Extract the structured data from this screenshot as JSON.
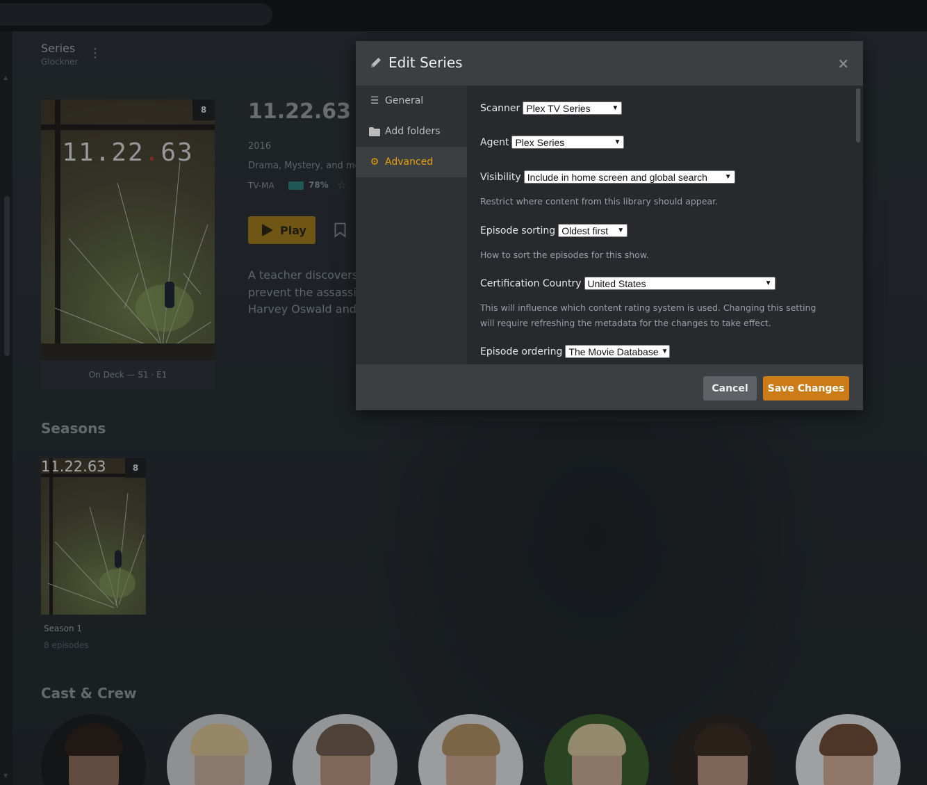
{
  "breadcrumb": {
    "title": "Series",
    "subtitle": "Glockner"
  },
  "show": {
    "poster_title_a": "11.22",
    "poster_title_dot": ".",
    "poster_title_b": "63",
    "poster_badge": "8",
    "on_deck": "On Deck — S1 · E1",
    "title": "11.22.63",
    "year": "2016",
    "genres": "Drama, Mystery, and mo",
    "content_rating": "TV-MA",
    "critic_score": "78%",
    "play_label": "Play",
    "summary_lines": [
      "A teacher discovers a",
      "prevent the assassina",
      "Harvey Oswald and th"
    ]
  },
  "seasons": {
    "heading": "Seasons",
    "items": [
      {
        "label": "Season 1",
        "count": "8 episodes",
        "badge": "8"
      }
    ]
  },
  "cast": {
    "heading": "Cast & Crew"
  },
  "modal": {
    "title": "Edit Series",
    "close": "×",
    "nav": [
      {
        "label": "General",
        "icon": "list-icon"
      },
      {
        "label": "Add folders",
        "icon": "folder-icon"
      },
      {
        "label": "Advanced",
        "icon": "gear-icon",
        "active": true
      }
    ],
    "fields": {
      "scanner": {
        "label": "Scanner",
        "value": "Plex TV Series"
      },
      "agent": {
        "label": "Agent",
        "value": "Plex Series"
      },
      "visibility": {
        "label": "Visibility",
        "value": "Include in home screen and global search",
        "help": "Restrict where content from this library should appear."
      },
      "episode_sorting": {
        "label": "Episode sorting",
        "value": "Oldest first",
        "help": "How to sort the episodes for this show."
      },
      "certification_country": {
        "label": "Certification Country",
        "value": "United States",
        "help": "This will influence which content rating system is used. Changing this setting will require refreshing the metadata for the changes to take effect."
      },
      "episode_ordering": {
        "label": "Episode ordering",
        "value": "The Movie Database"
      }
    },
    "cancel_label": "Cancel",
    "save_label": "Save Changes"
  },
  "colors": {
    "accent": "#e5a00d",
    "save_button": "#cc7b19",
    "cancel_button": "#5e6165"
  }
}
